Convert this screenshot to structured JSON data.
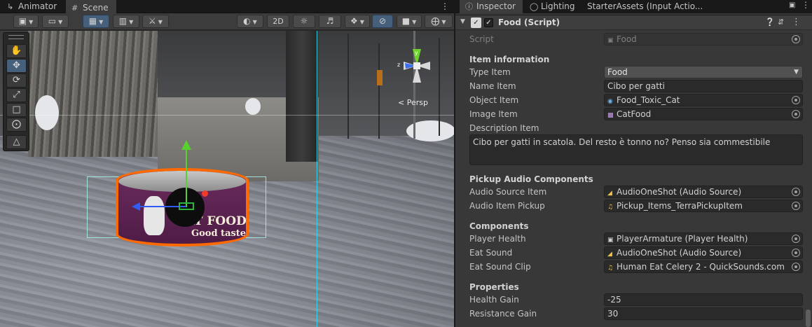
{
  "left_tabs": [
    {
      "label": "Animator",
      "icon": "animator-icon"
    },
    {
      "label": "Scene",
      "icon": "grid-icon"
    }
  ],
  "scene_toolbar": {
    "mode_2d": "2D"
  },
  "viewport": {
    "persp_label": "< Persp",
    "can_text_1": "CAT FOOD",
    "can_text_2": "Good taste",
    "axis_y": "y",
    "axis_z": "z"
  },
  "tools": [
    "hand",
    "move",
    "rotate",
    "scale",
    "rect",
    "transform",
    "custom"
  ],
  "inspector": {
    "tabs": [
      {
        "label": "Inspector",
        "icon": "info-icon"
      },
      {
        "label": "Lighting",
        "icon": "lightbulb-icon"
      },
      {
        "label": "StarterAssets (Input Actio..."
      }
    ],
    "component": {
      "title": "Food (Script)",
      "enabled": true
    },
    "script": {
      "label": "Script",
      "value": "Food"
    },
    "item_information": {
      "header": "Item information",
      "type_item": {
        "label": "Type Item",
        "value": "Food"
      },
      "name_item": {
        "label": "Name Item",
        "value": "Cibo per gatti"
      },
      "object_item": {
        "label": "Object Item",
        "value": "Food_Toxic_Cat"
      },
      "image_item": {
        "label": "Image Item",
        "value": "CatFood"
      },
      "description_item": {
        "label": "Description Item",
        "value": "Cibo per gatti in scatola. Del resto è tonno no? Penso sia commestibile"
      }
    },
    "pickup_audio": {
      "header": "Pickup Audio Components",
      "audio_source_item": {
        "label": "Audio Source Item",
        "value": "AudioOneShot (Audio Source)"
      },
      "audio_item_pickup": {
        "label": "Audio Item Pickup",
        "value": "Pickup_Items_TerraPickupItem"
      }
    },
    "components": {
      "header": "Components",
      "player_health": {
        "label": "Player Health",
        "value": "PlayerArmature (Player Health)"
      },
      "eat_sound": {
        "label": "Eat Sound",
        "value": "AudioOneShot (Audio Source)"
      },
      "eat_sound_clip": {
        "label": "Eat Sound Clip",
        "value": "Human Eat Celery 2 - QuickSounds.com"
      }
    },
    "properties": {
      "header": "Properties",
      "health_gain": {
        "label": "Health Gain",
        "value": "-25"
      },
      "resistance_gain": {
        "label": "Resistance Gain",
        "value": "30"
      }
    }
  },
  "colors": {
    "selection_outline": "#ff6a00",
    "toolbar_active": "#46607c",
    "gizmo_x": "#2f5df5",
    "gizmo_y": "#58d12e",
    "gizmo_z": "#f03b2b",
    "bounds": "#35d7e6"
  }
}
